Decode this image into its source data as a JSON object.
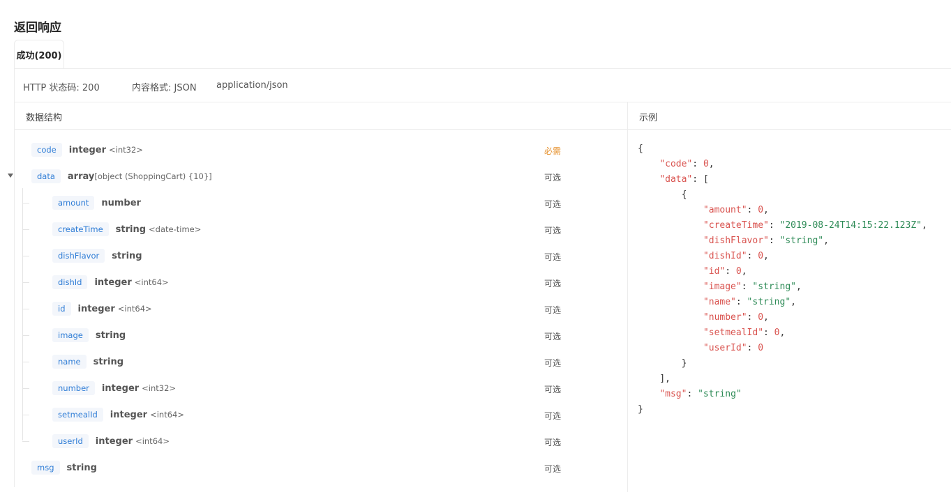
{
  "section_title": "返回响应",
  "tab": {
    "label": "成功(200)"
  },
  "status": {
    "http_code": "HTTP 状态码: 200",
    "content_format": "内容格式: JSON",
    "mime": "application/json"
  },
  "headers": {
    "structure": "数据结构",
    "example": "示例"
  },
  "fields": [
    {
      "name": "code",
      "type": "integer",
      "format": "<int32>",
      "required": "必需"
    },
    {
      "name": "data",
      "type": "array",
      "format": "[object (ShoppingCart) {10}]",
      "required": "可选"
    },
    {
      "name": "amount",
      "type": "number",
      "format": "",
      "required": "可选"
    },
    {
      "name": "createTime",
      "type": "string",
      "format": "<date-time>",
      "required": "可选"
    },
    {
      "name": "dishFlavor",
      "type": "string",
      "format": "",
      "required": "可选"
    },
    {
      "name": "dishId",
      "type": "integer",
      "format": "<int64>",
      "required": "可选"
    },
    {
      "name": "id",
      "type": "integer",
      "format": "<int64>",
      "required": "可选"
    },
    {
      "name": "image",
      "type": "string",
      "format": "",
      "required": "可选"
    },
    {
      "name": "name",
      "type": "string",
      "format": "",
      "required": "可选"
    },
    {
      "name": "number",
      "type": "integer",
      "format": "<int32>",
      "required": "可选"
    },
    {
      "name": "setmealId",
      "type": "integer",
      "format": "<int64>",
      "required": "可选"
    },
    {
      "name": "userId",
      "type": "integer",
      "format": "<int64>",
      "required": "可选"
    },
    {
      "name": "msg",
      "type": "string",
      "format": "",
      "required": "可选"
    }
  ],
  "example": {
    "open_brace": "{",
    "close_brace": "}",
    "code_key": "\"code\"",
    "code_val": "0",
    "data_key": "\"data\"",
    "data_open": "[",
    "data_close": "],",
    "item_open": "{",
    "item_close": "}",
    "item": [
      {
        "key": "\"amount\"",
        "val": "0",
        "kind": "n"
      },
      {
        "key": "\"createTime\"",
        "val": "\"2019-08-24T14:15:22.123Z\"",
        "kind": "s"
      },
      {
        "key": "\"dishFlavor\"",
        "val": "\"string\"",
        "kind": "s"
      },
      {
        "key": "\"dishId\"",
        "val": "0",
        "kind": "n"
      },
      {
        "key": "\"id\"",
        "val": "0",
        "kind": "n"
      },
      {
        "key": "\"image\"",
        "val": "\"string\"",
        "kind": "s"
      },
      {
        "key": "\"name\"",
        "val": "\"string\"",
        "kind": "s"
      },
      {
        "key": "\"number\"",
        "val": "0",
        "kind": "n"
      },
      {
        "key": "\"setmealId\"",
        "val": "0",
        "kind": "n"
      },
      {
        "key": "\"userId\"",
        "val": "0",
        "kind": "n"
      }
    ],
    "msg_key": "\"msg\"",
    "msg_val": "\"string\""
  },
  "colors": {
    "tag_text": "#2f7dd6",
    "required": "#e6912d",
    "json_key": "#d9534f",
    "json_string": "#2e8b57"
  }
}
